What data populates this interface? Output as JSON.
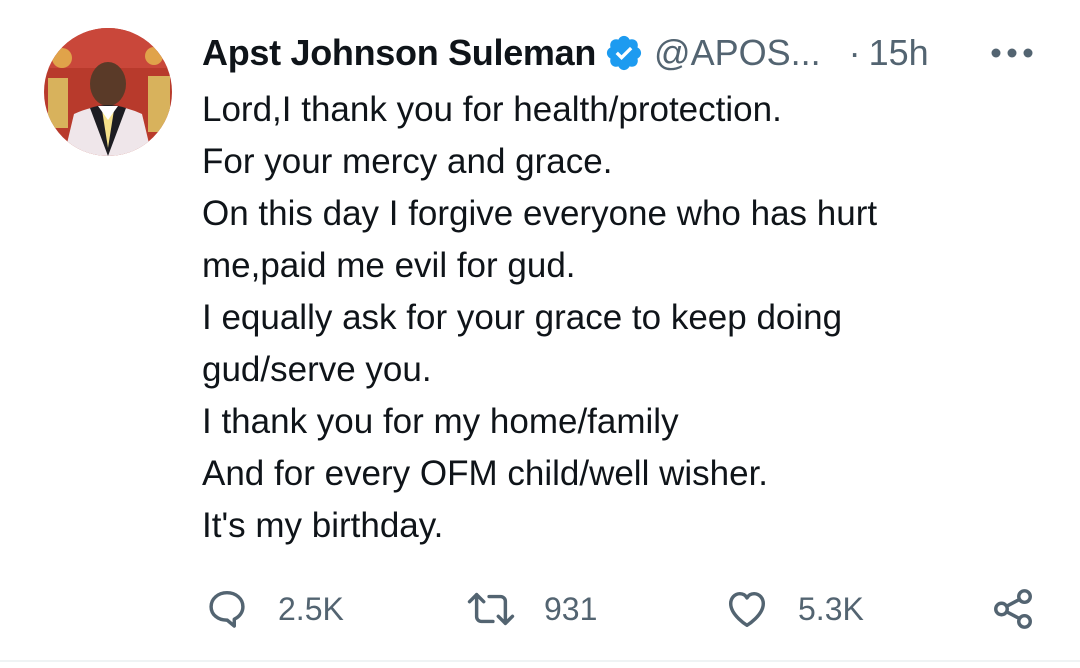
{
  "tweet": {
    "author": {
      "display_name": "Apst Johnson Suleman",
      "handle": "@APOS...",
      "verified": true,
      "avatar_icon": "profile-photo"
    },
    "separator": "·",
    "time": "15h",
    "text_lines": [
      "Lord,I thank you for health/protection.",
      "For your mercy and grace.",
      "On this day I forgive everyone who has hurt",
      "me,paid me evil for gud.",
      "I equally ask for your grace to keep doing",
      "gud/serve you.",
      "I thank you for my home/family",
      "And for every OFM child/well wisher.",
      "It's my birthday."
    ],
    "actions": {
      "reply": {
        "icon": "reply-icon",
        "count": "2.5K"
      },
      "retweet": {
        "icon": "retweet-icon",
        "count": "931"
      },
      "like": {
        "icon": "like-icon",
        "count": "5.3K"
      },
      "share": {
        "icon": "share-icon"
      }
    },
    "more_icon": "more-icon"
  },
  "colors": {
    "text_primary": "#0f1419",
    "text_secondary": "#536471",
    "verified_blue": "#1d9bf0"
  }
}
